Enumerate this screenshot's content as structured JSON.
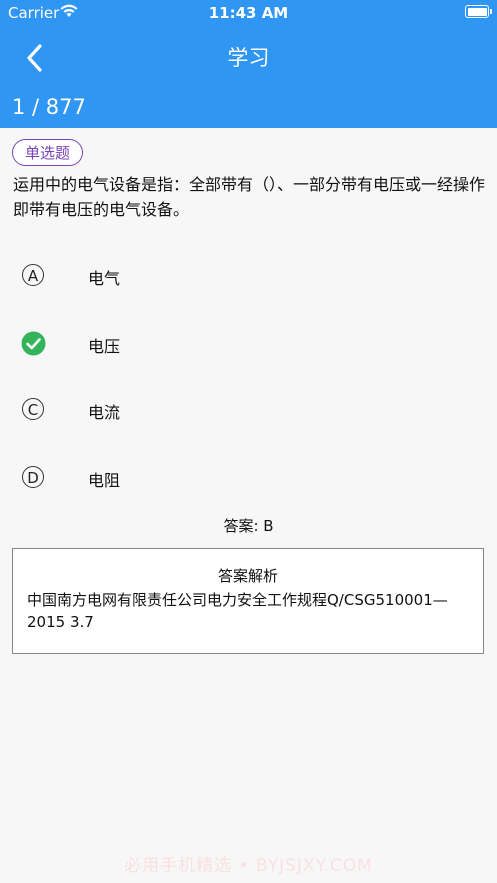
{
  "status_bar": {
    "carrier": "Carrier",
    "time": "11:43 AM"
  },
  "nav": {
    "title": "学习",
    "progress": "1 / 877"
  },
  "question": {
    "type": "单选题",
    "text": "运用中的电气设备是指：全部带有（）、一部分带有电压或一经操作即带有电压的电气设备。",
    "options": [
      {
        "marker": "A",
        "label": "电气",
        "selected": false
      },
      {
        "marker": "B",
        "label": "电压",
        "selected": true
      },
      {
        "marker": "C",
        "label": "电流",
        "selected": false
      },
      {
        "marker": "D",
        "label": "电阻",
        "selected": false
      }
    ]
  },
  "answer": "答案: B",
  "analysis": {
    "title": "答案解析",
    "text": "中国南方电网有限责任公司电力安全工作规程Q/CSG510001—2015 3.7"
  },
  "watermark": "必用手机精选 • BYJSJXY.COM",
  "colors": {
    "primary": "#2f96f3",
    "badge": "#7a44b8",
    "correct": "#34b45a"
  }
}
